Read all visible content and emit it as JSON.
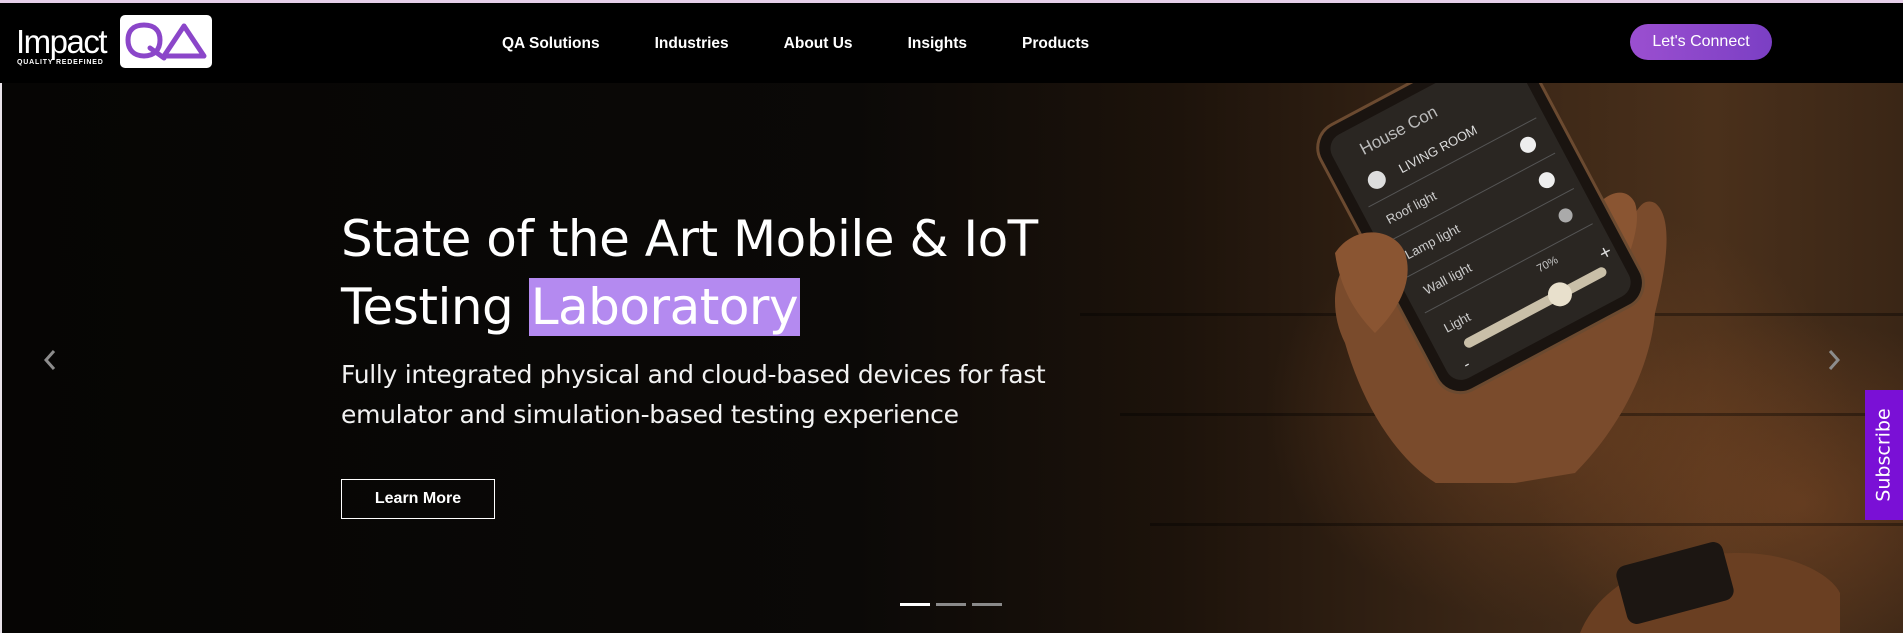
{
  "brand": {
    "word": "Impact",
    "tagline": "QUALITY REDEFINED",
    "mark": "QA",
    "accent": "#8b46c9"
  },
  "nav": {
    "items": [
      {
        "label": "QA Solutions"
      },
      {
        "label": "Industries"
      },
      {
        "label": "About Us"
      },
      {
        "label": "Insights"
      },
      {
        "label": "Products"
      }
    ]
  },
  "header": {
    "cta_label": "Let's Connect",
    "cta_color": "#8e47cd"
  },
  "hero": {
    "title_line1": "State of the Art Mobile & IoT",
    "title_line2_prefix": "Testing ",
    "title_highlight": "Laboratory",
    "highlight_color": "#b48af0",
    "subtitle": "Fully integrated physical and cloud-based devices for fast emulator and simulation-based testing experience",
    "button_label": "Learn More",
    "slides": 3,
    "active_slide": 1
  },
  "phone_screen": {
    "header": "House Con",
    "room": "LIVING ROOM",
    "rows": [
      "Roof light",
      "Lamp light",
      "Wall light"
    ],
    "slider_label": "Light",
    "slider_value": "70%",
    "minus": "-",
    "plus": "+"
  },
  "subscribe": {
    "label": "Subscribe",
    "color": "#7a10d6"
  },
  "icons": {
    "prev": "chevron-left-icon",
    "next": "chevron-right-icon"
  }
}
